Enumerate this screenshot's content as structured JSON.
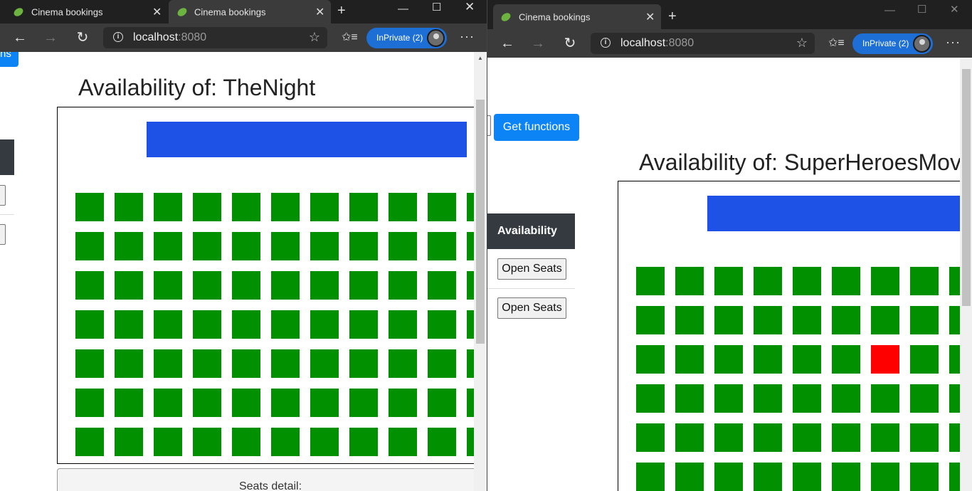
{
  "left_window": {
    "tabs": [
      {
        "title": "Cinema bookings",
        "close": "✕"
      },
      {
        "title": "Cinema bookings",
        "close": "✕"
      }
    ],
    "new_tab": "+",
    "window_controls": {
      "minimize": "—",
      "maximize": "☐",
      "close": "✕"
    },
    "address": {
      "host": "localhost",
      "port": ":8080"
    },
    "inprivate": "InPrivate (2)",
    "page": {
      "get_functions_fragment": "ns",
      "title": "Availability of: TheNight",
      "seats_detail_label": "Seats detail:"
    }
  },
  "right_window": {
    "tabs": [
      {
        "title": "Cinema bookings",
        "close": "✕"
      }
    ],
    "new_tab": "+",
    "window_controls": {
      "minimize": "—",
      "maximize": "☐",
      "close": "✕"
    },
    "address": {
      "host": "localhost",
      "port": ":8080"
    },
    "inprivate": "InPrivate (2)",
    "page": {
      "get_functions": "Get functions",
      "title": "Availability of: SuperHeroesMovie",
      "sidebar_heading": "Availability",
      "open_seats_1": "Open Seats",
      "open_seats_2": "Open Seats"
    }
  },
  "icons": {
    "back": "back-arrow-icon",
    "forward": "forward-arrow-icon",
    "refresh": "refresh-icon",
    "favorite": "star-icon",
    "favorites_bar": "favorites-icon",
    "more": "more-icon",
    "tab_favicon": "spring-leaf-icon"
  },
  "colors": {
    "seat_free": "#009000",
    "seat_taken": "#ff0000",
    "screen": "#1e52e6",
    "primary_button": "#0d84f5"
  },
  "seat_map_left": {
    "status": [
      [
        "free",
        "free",
        "free",
        "free",
        "free",
        "free",
        "free",
        "free",
        "free",
        "free",
        "free"
      ],
      [
        "free",
        "free",
        "free",
        "free",
        "free",
        "free",
        "free",
        "free",
        "free",
        "free",
        "free"
      ],
      [
        "free",
        "free",
        "free",
        "free",
        "free",
        "free",
        "free",
        "free",
        "free",
        "free",
        "free"
      ],
      [
        "free",
        "free",
        "free",
        "free",
        "free",
        "free",
        "free",
        "free",
        "free",
        "free",
        "free"
      ],
      [
        "free",
        "free",
        "free",
        "free",
        "free",
        "free",
        "free",
        "free",
        "free",
        "free",
        "free"
      ],
      [
        "free",
        "free",
        "free",
        "free",
        "free",
        "free",
        "free",
        "free",
        "free",
        "free",
        "free"
      ],
      [
        "free",
        "free",
        "free",
        "free",
        "free",
        "free",
        "free",
        "free",
        "free",
        "free",
        "free"
      ]
    ]
  },
  "seat_map_right": {
    "status": [
      [
        "free",
        "free",
        "free",
        "free",
        "free",
        "free",
        "free",
        "free",
        "free"
      ],
      [
        "free",
        "free",
        "free",
        "free",
        "free",
        "free",
        "free",
        "free",
        "free"
      ],
      [
        "free",
        "free",
        "free",
        "free",
        "free",
        "free",
        "taken",
        "free",
        "free"
      ],
      [
        "free",
        "free",
        "free",
        "free",
        "free",
        "free",
        "free",
        "free",
        "free"
      ],
      [
        "free",
        "free",
        "free",
        "free",
        "free",
        "free",
        "free",
        "free",
        "free"
      ],
      [
        "free",
        "free",
        "free",
        "free",
        "free",
        "free",
        "free",
        "free",
        "free"
      ]
    ]
  }
}
